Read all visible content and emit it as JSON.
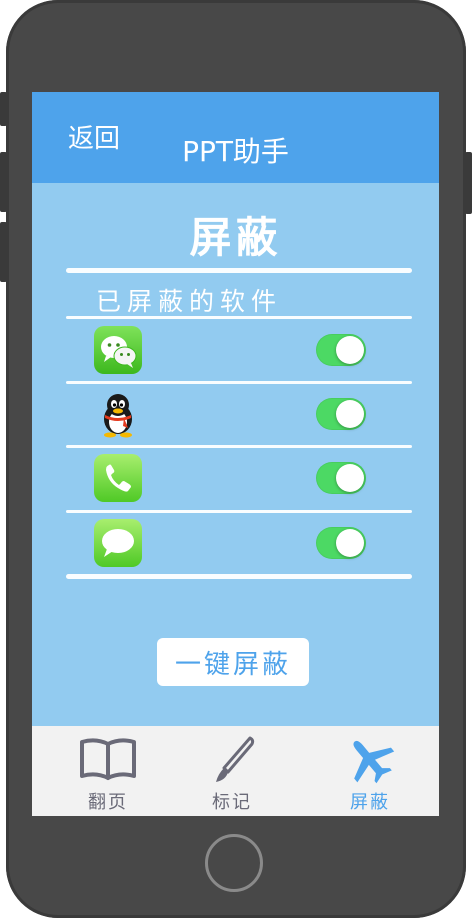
{
  "header": {
    "back_label": "返回",
    "title": "PPT助手"
  },
  "page": {
    "title": "屏蔽",
    "section_label": "已屏蔽的软件"
  },
  "apps": [
    {
      "icon": "wechat-icon",
      "enabled": true
    },
    {
      "icon": "qq-penguin-icon",
      "enabled": true
    },
    {
      "icon": "phone-icon",
      "enabled": true
    },
    {
      "icon": "messages-icon",
      "enabled": true
    }
  ],
  "action": {
    "one_key_label": "一键屏蔽"
  },
  "tabs": [
    {
      "label": "翻页",
      "icon": "book-icon",
      "active": false
    },
    {
      "label": "标记",
      "icon": "brush-icon",
      "active": false
    },
    {
      "label": "屏蔽",
      "icon": "airplane-icon",
      "active": true
    }
  ],
  "colors": {
    "header": "#4ea3eb",
    "background": "#92cbf0",
    "toggle_on": "#4cd964",
    "tab_active": "#4ea3eb",
    "tab_inactive": "#6a6a78"
  }
}
